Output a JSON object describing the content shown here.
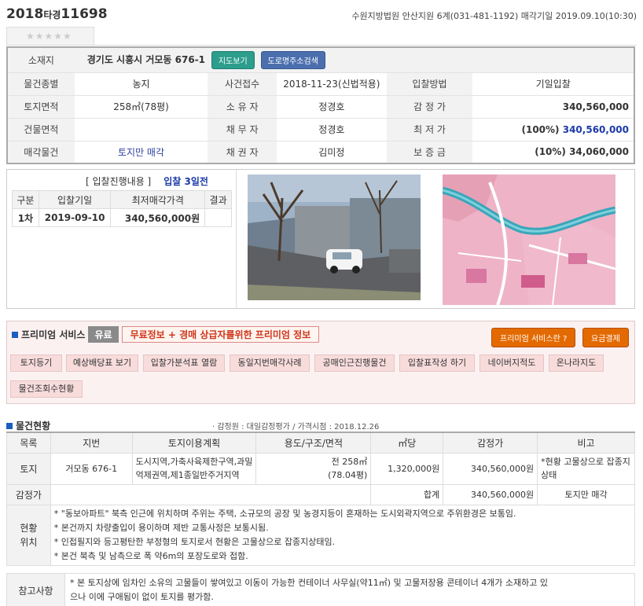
{
  "header": {
    "case_year": "2018",
    "case_kind": "타경",
    "case_number": "11698",
    "court_info": "수원지방법원 안산지원 6계(031-481-1192) 매각기일 2019.09.10(10:30)"
  },
  "rating": "★★★★★",
  "summary": {
    "location_label": "소재지",
    "location_value": "경기도 시흥시 거모동 676-1",
    "map_button": "지도보기",
    "road_button": "도로명주소검색",
    "rows": [
      {
        "l1": "물건종별",
        "v1": "농지",
        "l2": "사건접수",
        "v2": "2018-11-23(신법적용)",
        "l3": "입찰방법",
        "v3": "기일입찰"
      },
      {
        "l1": "토지면적",
        "v1": "258㎡(78평)",
        "l2": "소 유 자",
        "v2": "정경호",
        "l3": "감 정 가",
        "v3": "340,560,000"
      },
      {
        "l1": "건물면적",
        "v1": "",
        "l2": "채 무 자",
        "v2": "정경호",
        "l3": "최 저 가",
        "v3_pct": "(100%)",
        "v3": "340,560,000"
      },
      {
        "l1": "매각물건",
        "v1": "토지만 매각",
        "l2": "채 권 자",
        "v2": "김미정",
        "l3": "보 증 금",
        "v3": "(10%) 34,060,000"
      }
    ]
  },
  "bid": {
    "title": "[ 입찰진행내용 ]",
    "days_left": "입찰 3일전",
    "headers": [
      "구분",
      "입찰기일",
      "최저매각가격",
      "결과"
    ],
    "rows": [
      {
        "round": "1차",
        "date": "2019-09-10",
        "price": "340,560,000원",
        "result": ""
      }
    ]
  },
  "premium": {
    "title": "프리미엄 서비스",
    "badge": "유료",
    "desc": "무료정보 + 경매 상급자를위한 프리미엄 정보",
    "btn_about": "프리미엄 서비스란 ?",
    "btn_pay": "요금결제",
    "tags": [
      "토지등기",
      "예상배당표 보기",
      "입찰가분석표 열람",
      "동일지번매각사례",
      "공매인근진행물건",
      "입찰표작성 하기",
      "네이버지적도",
      "온나라지도",
      "물건조회수현황"
    ]
  },
  "status": {
    "title": "물건현황",
    "subtitle": "· 감정원 : 대일감정평가 / 가격시점 : 2018.12.26",
    "headers": [
      "목록",
      "지번",
      "토지이용계획",
      "용도/구조/면적",
      "㎡당",
      "감정가",
      "비고"
    ],
    "row": {
      "kind": "토지",
      "lot": "거모동 676-1",
      "plan": "도시지역,가축사육제한구역,과밀억제권역,제1종일반주거지역",
      "area_line1": "전 258㎡",
      "area_line2": "(78.04평)",
      "per_m2": "1,320,000원",
      "appraisal": "340,560,000원",
      "note": "*현황 고물상으로 잡종지 상태"
    },
    "total": {
      "label": "감정가",
      "sum_label": "합계",
      "sum_value": "340,560,000원",
      "note": "토지만 매각"
    },
    "situation_label_1": "현황",
    "situation_label_2": "위치",
    "situation": [
      "* \"동보아파트\" 북측 인근에 위치하며 주위는 주택, 소규모의 공장 및 농경지등이 혼재하는 도시외곽지역으로 주위환경은 보통임.",
      "* 본건까지 차량출입이 용이하며 제반 교통사정은 보통시됨.",
      "* 인접필지와 등고평탄한 부정형의 토지로서 현황은 고물상으로 잡종지상태임.",
      "* 본건 북측 및 남측으로 폭 약6m의 포장도로와 접함."
    ]
  },
  "remark": {
    "label": "참고사항",
    "line1": "* 본 토지상에 임차인 소유의 고물들이 쌓여있고 이동이 가능한 컨테이너 사무실(약11㎡) 및 고물저장용 콘테이너 4개가 소재하고 있",
    "line2": "으나 이에 구애됨이 없이 토지를 평가함."
  }
}
